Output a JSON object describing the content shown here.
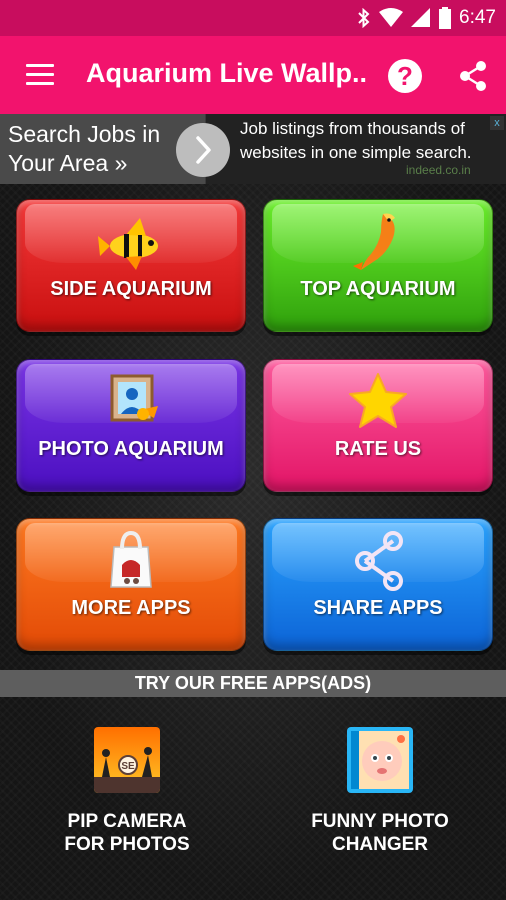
{
  "status_bar": {
    "time": "6:47",
    "icons": [
      "bluetooth-icon",
      "wifi-icon",
      "signal-icon",
      "battery-icon"
    ]
  },
  "app_bar": {
    "title": "Aquarium Live Wallp...",
    "icons": [
      "menu-icon",
      "help-icon",
      "share-icon"
    ]
  },
  "ad": {
    "headline": "Search Jobs in Your Area »",
    "body_line1": "Job listings from thousands of",
    "body_line2": "websites in one simple search.",
    "domain": "indeed.co.in",
    "close": "x"
  },
  "tiles": [
    {
      "label": "SIDE AQUARIUM",
      "icon": "fish-icon",
      "color": "#e52424"
    },
    {
      "label": "TOP AQUARIUM",
      "icon": "koi-fish-icon",
      "color": "#4cd01c"
    },
    {
      "label": "PHOTO AQUARIUM",
      "icon": "photo-frame-icon",
      "color": "#6122d6"
    },
    {
      "label": "RATE US",
      "icon": "star-icon",
      "color": "#f5307f"
    },
    {
      "label": "MORE APPS",
      "icon": "shopping-bag-icon",
      "color": "#f26014"
    },
    {
      "label": "SHARE APPS",
      "icon": "share-icon",
      "color": "#1a82ec"
    }
  ],
  "free_apps": {
    "header": "TRY OUR FREE APPS(ADS)",
    "apps": [
      {
        "line1": "PIP CAMERA",
        "line2": "FOR PHOTOS",
        "icon": "pip-camera-app-icon"
      },
      {
        "line1": "FUNNY PHOTO",
        "line2": "CHANGER",
        "icon": "funny-photo-app-icon"
      }
    ]
  },
  "colors": {
    "status_bar": "#c80d5e",
    "app_bar": "#f2136d",
    "background": "#151515"
  }
}
